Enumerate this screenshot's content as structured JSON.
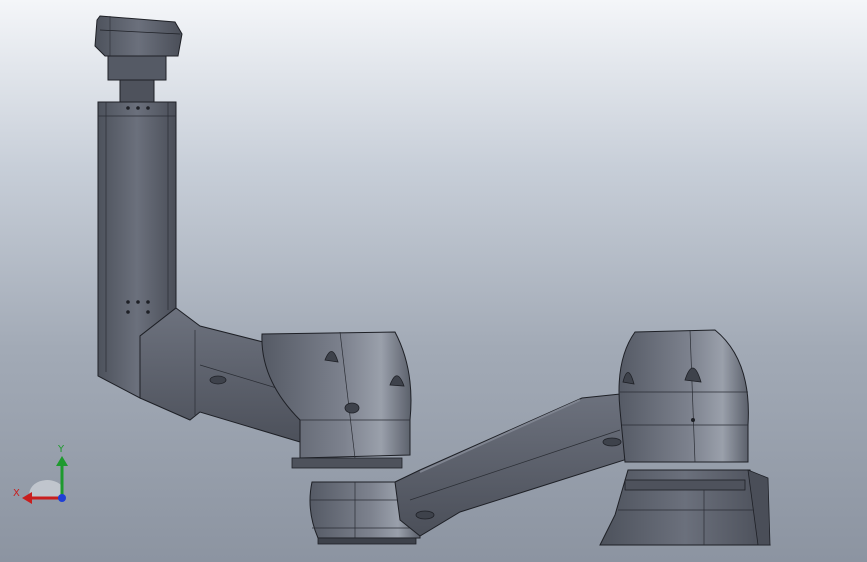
{
  "triad": {
    "x_label": "X",
    "y_label": "Y",
    "colors": {
      "x_axis": "#c81e1e",
      "y_axis": "#1e9a2e",
      "z_axis": "#1f3fd6"
    }
  },
  "model": {
    "colors": {
      "body": "#5f6470",
      "body_light": "#7a7f8b",
      "body_dark": "#3e424b",
      "edge": "#1e2026",
      "highlight": "#9ea3ae"
    }
  }
}
